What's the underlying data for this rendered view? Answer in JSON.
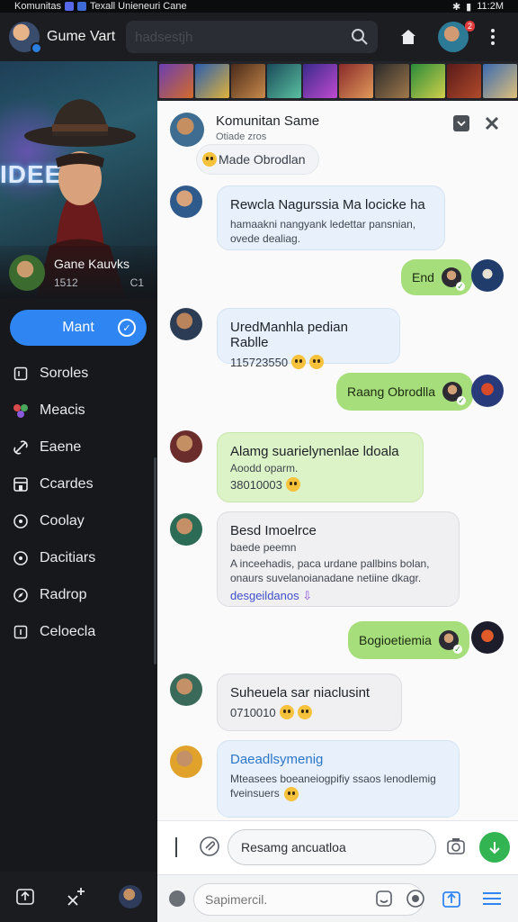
{
  "status": {
    "left_text": "Komunitas",
    "left_text2": "Texall Unieneuri Cane",
    "time": "11:2M"
  },
  "appbar": {
    "title": "Gume Vart",
    "search_placeholder": "hadsestjh",
    "notif_count": "2"
  },
  "sidebar": {
    "hero_text": "IDEE",
    "hero_name": "Gane Kauvks",
    "hero_sub_left": "1512",
    "hero_sub_right": "C1",
    "primary_button": "Mant",
    "items": [
      {
        "label": "Soroles",
        "icon": "square-outline-icon"
      },
      {
        "label": "Meacis",
        "icon": "multi-dot-icon"
      },
      {
        "label": "Eaene",
        "icon": "link-icon"
      },
      {
        "label": "Ccardes",
        "icon": "store-icon"
      },
      {
        "label": "Coolay",
        "icon": "target-icon"
      },
      {
        "label": "Dacitiars",
        "icon": "target-icon"
      },
      {
        "label": "Radrop",
        "icon": "compass-icon"
      },
      {
        "label": "Celoecla",
        "icon": "info-square-icon"
      }
    ]
  },
  "chat": {
    "title": "Komunitan Same",
    "subtitle": "Otiade zros",
    "chip": "Made Obrodlan",
    "messages": [
      {
        "kind": "in",
        "title": "Rewcla Nagurssia Ma locicke ha",
        "sub": "hamaakni nangyank ledettar pansnian, ovede dealiag."
      },
      {
        "kind": "out",
        "text": "End"
      },
      {
        "kind": "in",
        "title": "UredManhla pedian Rablle",
        "code": "115723550"
      },
      {
        "kind": "out",
        "text": "Raang Obrodlla"
      },
      {
        "kind": "in",
        "title": "Alamg suarielynenlae ldoala",
        "sub": "Aoodd oparm.",
        "code": "38010003"
      },
      {
        "kind": "in",
        "title": "Besd Imoelrce",
        "sub": "baede peemn",
        "sub2": "A inceehadis, paca urdane pallbins bolan, onaurs suvelanoianadane netiine dkagr.",
        "link": "desgeildanos"
      },
      {
        "kind": "out",
        "text": "Bogioetiemia"
      },
      {
        "kind": "in",
        "title": "Suheuela sar niaclusint",
        "code": "0710010"
      },
      {
        "kind": "in",
        "title": "Daeadlsymenig",
        "sub": "Mteasees boeaneiogpifiy ssaos lenodlemig fveinsuers"
      }
    ]
  },
  "composer": {
    "value": "Resamg ancuatloa"
  },
  "bottom": {
    "placeholder": "Sapimercil."
  },
  "colors": {
    "accent": "#2f86f3",
    "outgoing": "#a5de7a",
    "send": "#31b451"
  }
}
